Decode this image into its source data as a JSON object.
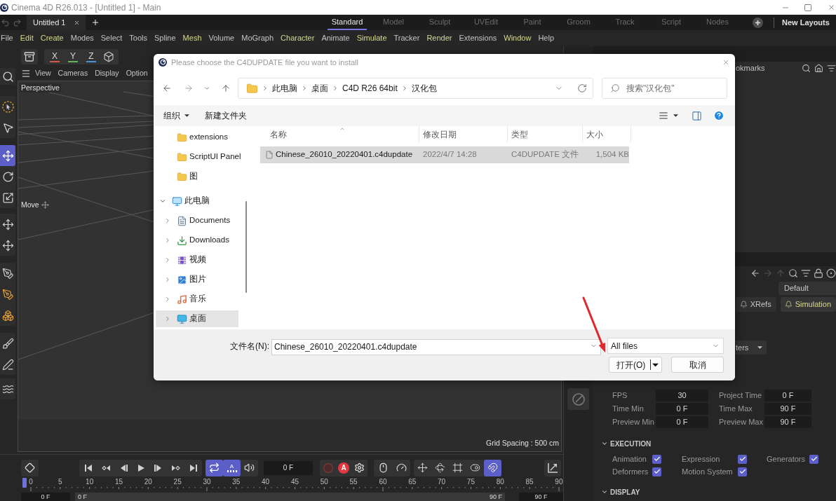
{
  "window": {
    "title": "Cinema 4D R26.013 - [Untitled 1] - Main"
  },
  "document_tab": {
    "label": "Untitled 1"
  },
  "layouts": [
    {
      "label": "Standard",
      "selected": true
    },
    {
      "label": "Model",
      "selected": false
    },
    {
      "label": "Sculpt",
      "selected": false
    },
    {
      "label": "UVEdit",
      "selected": false
    },
    {
      "label": "Paint",
      "selected": false
    },
    {
      "label": "Groom",
      "selected": false
    },
    {
      "label": "Track",
      "selected": false
    },
    {
      "label": "Script",
      "selected": false
    },
    {
      "label": "Nodes",
      "selected": false
    }
  ],
  "new_layouts": "New Layouts",
  "menu": [
    {
      "label": "File",
      "highlighted": false
    },
    {
      "label": "Edit",
      "highlighted": true
    },
    {
      "label": "Create",
      "highlighted": true
    },
    {
      "label": "Modes",
      "highlighted": false
    },
    {
      "label": "Select",
      "highlighted": false
    },
    {
      "label": "Tools",
      "highlighted": false
    },
    {
      "label": "Spline",
      "highlighted": false
    },
    {
      "label": "Mesh",
      "highlighted": true
    },
    {
      "label": "Volume",
      "highlighted": false
    },
    {
      "label": "MoGraph",
      "highlighted": false
    },
    {
      "label": "Character",
      "highlighted": true
    },
    {
      "label": "Animate",
      "highlighted": false
    },
    {
      "label": "Simulate",
      "highlighted": true
    },
    {
      "label": "Tracker",
      "highlighted": false
    },
    {
      "label": "Render",
      "highlighted": true
    },
    {
      "label": "Extensions",
      "highlighted": false
    },
    {
      "label": "Window",
      "highlighted": true
    },
    {
      "label": "Help",
      "highlighted": false
    }
  ],
  "axes": [
    {
      "label": "X",
      "color": "#d9534f"
    },
    {
      "label": "Y",
      "color": "#5cb85c"
    },
    {
      "label": "Z",
      "color": "#4a8fd9"
    }
  ],
  "tool_groups": [
    [
      {
        "kind": "search",
        "selected": false
      }
    ],
    [
      {
        "kind": "live-select",
        "selected": false
      },
      {
        "kind": "select-options",
        "selected": false
      }
    ],
    [
      {
        "kind": "move",
        "selected": true
      },
      {
        "kind": "rotate",
        "selected": false
      },
      {
        "kind": "scale",
        "selected": false
      }
    ],
    [
      {
        "kind": "move-axis",
        "selected": false
      },
      {
        "kind": "move-points",
        "selected": false
      }
    ],
    [
      {
        "kind": "pen-arc",
        "selected": false
      },
      {
        "kind": "pen-point",
        "selected": false
      },
      {
        "kind": "pen-cubes",
        "selected": false
      }
    ],
    [
      {
        "kind": "brush",
        "selected": false
      },
      {
        "kind": "pen-line",
        "selected": false
      }
    ],
    [
      {
        "kind": "spline",
        "selected": false
      }
    ]
  ],
  "viewport": {
    "menu": [
      "View",
      "Cameras",
      "Display",
      "Option"
    ],
    "camera": "Perspective",
    "tool_hint": "Move",
    "grid_spacing": "Grid Spacing : 500 cm"
  },
  "timeline": {
    "toggles": [
      {
        "kind": "loop",
        "selected": true
      },
      {
        "kind": "preview-range",
        "label": "A",
        "selected": true
      },
      {
        "kind": "sound",
        "selected": false
      }
    ],
    "current_frame": "0 F",
    "autokey": "A",
    "snap_tools": [
      {
        "kind": "move-axis",
        "selected": false
      },
      {
        "kind": "rotate-axis",
        "selected": false
      },
      {
        "kind": "scale-frame",
        "selected": false
      },
      {
        "kind": "toggle",
        "selected": false
      },
      {
        "kind": "snap",
        "selected": true
      }
    ],
    "ruler": {
      "labels": [
        "0",
        "5",
        "10",
        "15",
        "20",
        "25",
        "30",
        "35",
        "40",
        "45",
        "50",
        "55",
        "60",
        "65",
        "70",
        "75",
        "80",
        "85",
        "90"
      ],
      "level": 0
    },
    "range": {
      "min_field": "0 F",
      "start": "0 F",
      "end": "90 F",
      "max_field": "90 F"
    }
  },
  "object_manager": {
    "menu_tail": "okmarks"
  },
  "attributes": {
    "mode": "Default",
    "tabs": [
      {
        "label": "XRefs",
        "selected": false
      },
      {
        "label": "Simulation",
        "selected": true
      }
    ],
    "filter": "ters",
    "time_fields": [
      {
        "label": "FPS",
        "value": "30"
      },
      {
        "label": "Project Time",
        "value": "0 F"
      },
      {
        "label": "Time Min",
        "value": "0 F"
      },
      {
        "label": "Time Max",
        "value": "90 F"
      },
      {
        "label": "Preview Min",
        "value": "0 F"
      },
      {
        "label": "Preview Max",
        "value": "90 F"
      }
    ],
    "sections": [
      {
        "title": "EXECUTION",
        "expanded": true,
        "options": [
          {
            "label": "Animation",
            "checked": true
          },
          {
            "label": "Expression",
            "checked": true
          },
          {
            "label": "Generators",
            "checked": true
          },
          {
            "label": "Deformers",
            "checked": true
          },
          {
            "label": "Motion System",
            "checked": true
          }
        ]
      },
      {
        "title": "DISPLAY",
        "expanded": true
      }
    ]
  },
  "dialog": {
    "title": "Please choose the C4DUPDATE file you want to install",
    "address": [
      "此电脑",
      "桌面",
      "C4D R26 64bit",
      "汉化包"
    ],
    "search": {
      "placeholder": "搜索\"汉化包\""
    },
    "commands": [
      {
        "label": "组织",
        "dropdown": true
      },
      {
        "label": "新建文件夹",
        "dropdown": false
      }
    ],
    "nav_pane": {
      "folders": [
        {
          "label": "extensions"
        },
        {
          "label": "ScriptUI Panel"
        },
        {
          "label": "图"
        }
      ],
      "tree": [
        {
          "label": "此电脑",
          "kind": "computer",
          "expanded": true,
          "selected": false,
          "children": [
            {
              "label": "Documents",
              "kind": "documents",
              "expanded": false,
              "selected": false
            },
            {
              "label": "Downloads",
              "kind": "downloads",
              "expanded": false,
              "selected": false
            },
            {
              "label": "视频",
              "kind": "videos",
              "expanded": false,
              "selected": false
            },
            {
              "label": "图片",
              "kind": "pictures",
              "expanded": false,
              "selected": false
            },
            {
              "label": "音乐",
              "kind": "music",
              "expanded": false,
              "selected": false
            },
            {
              "label": "桌面",
              "kind": "desktop",
              "expanded": false,
              "selected": true
            }
          ]
        }
      ]
    },
    "columns": [
      "名称",
      "修改日期",
      "类型",
      "大小"
    ],
    "files": [
      {
        "name": "Chinese_26010_20220401.c4dupdate",
        "modified": "2022/4/7 14:28",
        "type": "C4DUPDATE 文件",
        "size": "1,504 KB",
        "selected": true
      }
    ],
    "file_name": {
      "label": "文件名(N):",
      "value": "Chinese_26010_20220401.c4dupdate"
    },
    "file_type": {
      "value": "All files"
    },
    "buttons": [
      {
        "label": "打开(O)",
        "kind": "split"
      },
      {
        "label": "取消",
        "kind": "plain"
      }
    ]
  }
}
